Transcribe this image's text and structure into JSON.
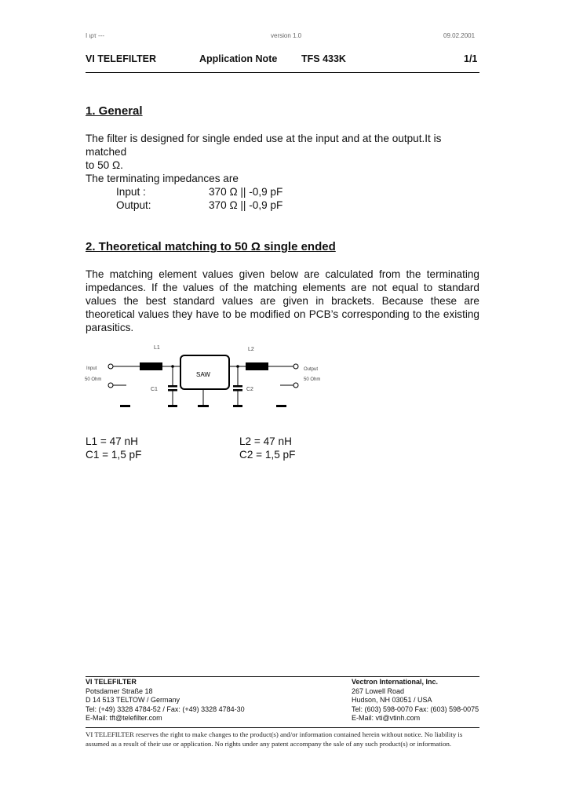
{
  "page_meta": {
    "left": "Ι ιρτ ---",
    "center": "version 1.0",
    "right": "09.02.2001"
  },
  "header": {
    "company": "VI TELEFILTER",
    "doc_type": "Application Note",
    "product": "TFS 433K",
    "page": "1/1"
  },
  "section1": {
    "title": "1. General",
    "para1_line1": "The filter is designed for single ended use at the input and at the output.It is matched",
    "para1_line2": "to 50 Ω.",
    "para2": "The terminating impedances are",
    "impedances": [
      {
        "label": "Input :",
        "value": "370 Ω || -0,9 pF"
      },
      {
        "label": "Output:",
        "value": "370 Ω || -0,9 pF"
      }
    ]
  },
  "section2": {
    "title": "2. Theoretical matching to 50 Ω single ended",
    "para": "The matching element values given below are calculated from the terminating impedances. If the values of the matching elements are not equal to standard values the best standard values are given in brackets. Because these are theoretical values they have to be modified on PCB’s corresponding to the existing parasitics."
  },
  "schematic": {
    "input_label": "Input",
    "input_imp": "50 Ohm",
    "output_label": "Output",
    "output_imp": "50 Ohm",
    "l1": "L1",
    "l2": "L2",
    "c1": "C1",
    "c2": "C2",
    "saw": "SAW"
  },
  "values": {
    "l1": "L1 = 47 nH",
    "c1": "C1 = 1,5 pF",
    "l2": "L2 = 47 nH",
    "c2": "C2 = 1,5 pF"
  },
  "footer": {
    "left": {
      "name": "VI TELEFILTER",
      "street": "Potsdamer Straße 18",
      "city": "D 14 513 TELTOW / Germany",
      "tel": "Tel: (+49) 3328 4784-52 / Fax: (+49) 3328 4784-30",
      "email": "E-Mail: tft@telefilter.com"
    },
    "right": {
      "name": "Vectron International, Inc.",
      "street": "267 Lowell Road",
      "city": "Hudson, NH 03051 / USA",
      "tel": "Tel: (603) 598-0070 Fax: (603) 598-0075",
      "email": "E-Mail: vti@vtinh.com"
    },
    "disclaimer_line1": "VI TELEFILTER reserves the right to make changes to the product(s) and/or information contained herein without notice.  No liability is",
    "disclaimer_line2": "assumed as a result of their use or application.  No rights under any patent accompany the sale of any such product(s) or information."
  }
}
